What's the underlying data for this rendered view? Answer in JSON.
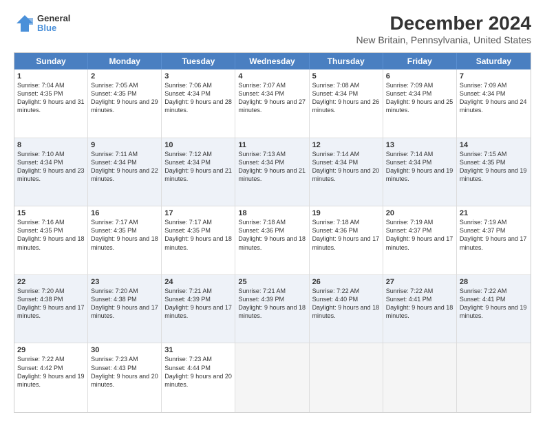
{
  "header": {
    "logo": {
      "line1": "General",
      "line2": "Blue"
    },
    "title": "December 2024",
    "subtitle": "New Britain, Pennsylvania, United States"
  },
  "weekdays": [
    "Sunday",
    "Monday",
    "Tuesday",
    "Wednesday",
    "Thursday",
    "Friday",
    "Saturday"
  ],
  "weeks": [
    {
      "alt": false,
      "days": [
        {
          "num": "1",
          "sunrise": "Sunrise: 7:04 AM",
          "sunset": "Sunset: 4:35 PM",
          "daylight": "Daylight: 9 hours and 31 minutes."
        },
        {
          "num": "2",
          "sunrise": "Sunrise: 7:05 AM",
          "sunset": "Sunset: 4:35 PM",
          "daylight": "Daylight: 9 hours and 29 minutes."
        },
        {
          "num": "3",
          "sunrise": "Sunrise: 7:06 AM",
          "sunset": "Sunset: 4:34 PM",
          "daylight": "Daylight: 9 hours and 28 minutes."
        },
        {
          "num": "4",
          "sunrise": "Sunrise: 7:07 AM",
          "sunset": "Sunset: 4:34 PM",
          "daylight": "Daylight: 9 hours and 27 minutes."
        },
        {
          "num": "5",
          "sunrise": "Sunrise: 7:08 AM",
          "sunset": "Sunset: 4:34 PM",
          "daylight": "Daylight: 9 hours and 26 minutes."
        },
        {
          "num": "6",
          "sunrise": "Sunrise: 7:09 AM",
          "sunset": "Sunset: 4:34 PM",
          "daylight": "Daylight: 9 hours and 25 minutes."
        },
        {
          "num": "7",
          "sunrise": "Sunrise: 7:09 AM",
          "sunset": "Sunset: 4:34 PM",
          "daylight": "Daylight: 9 hours and 24 minutes."
        }
      ]
    },
    {
      "alt": true,
      "days": [
        {
          "num": "8",
          "sunrise": "Sunrise: 7:10 AM",
          "sunset": "Sunset: 4:34 PM",
          "daylight": "Daylight: 9 hours and 23 minutes."
        },
        {
          "num": "9",
          "sunrise": "Sunrise: 7:11 AM",
          "sunset": "Sunset: 4:34 PM",
          "daylight": "Daylight: 9 hours and 22 minutes."
        },
        {
          "num": "10",
          "sunrise": "Sunrise: 7:12 AM",
          "sunset": "Sunset: 4:34 PM",
          "daylight": "Daylight: 9 hours and 21 minutes."
        },
        {
          "num": "11",
          "sunrise": "Sunrise: 7:13 AM",
          "sunset": "Sunset: 4:34 PM",
          "daylight": "Daylight: 9 hours and 21 minutes."
        },
        {
          "num": "12",
          "sunrise": "Sunrise: 7:14 AM",
          "sunset": "Sunset: 4:34 PM",
          "daylight": "Daylight: 9 hours and 20 minutes."
        },
        {
          "num": "13",
          "sunrise": "Sunrise: 7:14 AM",
          "sunset": "Sunset: 4:34 PM",
          "daylight": "Daylight: 9 hours and 19 minutes."
        },
        {
          "num": "14",
          "sunrise": "Sunrise: 7:15 AM",
          "sunset": "Sunset: 4:35 PM",
          "daylight": "Daylight: 9 hours and 19 minutes."
        }
      ]
    },
    {
      "alt": false,
      "days": [
        {
          "num": "15",
          "sunrise": "Sunrise: 7:16 AM",
          "sunset": "Sunset: 4:35 PM",
          "daylight": "Daylight: 9 hours and 18 minutes."
        },
        {
          "num": "16",
          "sunrise": "Sunrise: 7:17 AM",
          "sunset": "Sunset: 4:35 PM",
          "daylight": "Daylight: 9 hours and 18 minutes."
        },
        {
          "num": "17",
          "sunrise": "Sunrise: 7:17 AM",
          "sunset": "Sunset: 4:35 PM",
          "daylight": "Daylight: 9 hours and 18 minutes."
        },
        {
          "num": "18",
          "sunrise": "Sunrise: 7:18 AM",
          "sunset": "Sunset: 4:36 PM",
          "daylight": "Daylight: 9 hours and 18 minutes."
        },
        {
          "num": "19",
          "sunrise": "Sunrise: 7:18 AM",
          "sunset": "Sunset: 4:36 PM",
          "daylight": "Daylight: 9 hours and 17 minutes."
        },
        {
          "num": "20",
          "sunrise": "Sunrise: 7:19 AM",
          "sunset": "Sunset: 4:37 PM",
          "daylight": "Daylight: 9 hours and 17 minutes."
        },
        {
          "num": "21",
          "sunrise": "Sunrise: 7:19 AM",
          "sunset": "Sunset: 4:37 PM",
          "daylight": "Daylight: 9 hours and 17 minutes."
        }
      ]
    },
    {
      "alt": true,
      "days": [
        {
          "num": "22",
          "sunrise": "Sunrise: 7:20 AM",
          "sunset": "Sunset: 4:38 PM",
          "daylight": "Daylight: 9 hours and 17 minutes."
        },
        {
          "num": "23",
          "sunrise": "Sunrise: 7:20 AM",
          "sunset": "Sunset: 4:38 PM",
          "daylight": "Daylight: 9 hours and 17 minutes."
        },
        {
          "num": "24",
          "sunrise": "Sunrise: 7:21 AM",
          "sunset": "Sunset: 4:39 PM",
          "daylight": "Daylight: 9 hours and 17 minutes."
        },
        {
          "num": "25",
          "sunrise": "Sunrise: 7:21 AM",
          "sunset": "Sunset: 4:39 PM",
          "daylight": "Daylight: 9 hours and 18 minutes."
        },
        {
          "num": "26",
          "sunrise": "Sunrise: 7:22 AM",
          "sunset": "Sunset: 4:40 PM",
          "daylight": "Daylight: 9 hours and 18 minutes."
        },
        {
          "num": "27",
          "sunrise": "Sunrise: 7:22 AM",
          "sunset": "Sunset: 4:41 PM",
          "daylight": "Daylight: 9 hours and 18 minutes."
        },
        {
          "num": "28",
          "sunrise": "Sunrise: 7:22 AM",
          "sunset": "Sunset: 4:41 PM",
          "daylight": "Daylight: 9 hours and 19 minutes."
        }
      ]
    },
    {
      "alt": false,
      "days": [
        {
          "num": "29",
          "sunrise": "Sunrise: 7:22 AM",
          "sunset": "Sunset: 4:42 PM",
          "daylight": "Daylight: 9 hours and 19 minutes."
        },
        {
          "num": "30",
          "sunrise": "Sunrise: 7:23 AM",
          "sunset": "Sunset: 4:43 PM",
          "daylight": "Daylight: 9 hours and 20 minutes."
        },
        {
          "num": "31",
          "sunrise": "Sunrise: 7:23 AM",
          "sunset": "Sunset: 4:44 PM",
          "daylight": "Daylight: 9 hours and 20 minutes."
        },
        {
          "num": "",
          "sunrise": "",
          "sunset": "",
          "daylight": ""
        },
        {
          "num": "",
          "sunrise": "",
          "sunset": "",
          "daylight": ""
        },
        {
          "num": "",
          "sunrise": "",
          "sunset": "",
          "daylight": ""
        },
        {
          "num": "",
          "sunrise": "",
          "sunset": "",
          "daylight": ""
        }
      ]
    }
  ]
}
